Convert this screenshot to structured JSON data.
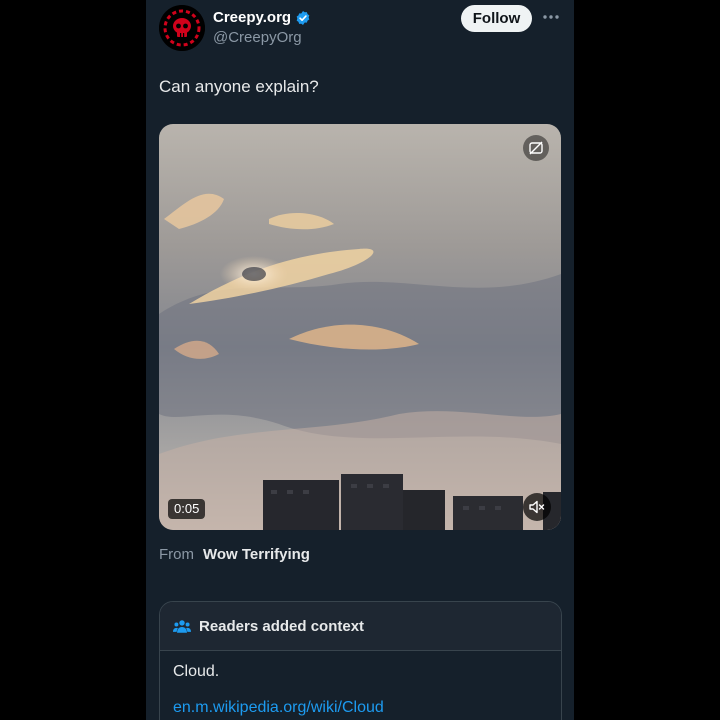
{
  "tweet": {
    "author_name": "Creepy.org",
    "author_handle": "@CreepyOrg",
    "follow_label": "Follow",
    "text": "Can anyone explain?"
  },
  "video": {
    "duration": "0:05"
  },
  "source": {
    "from_label": "From",
    "name": "Wow Terrifying"
  },
  "community_note": {
    "header": "Readers added context",
    "body": "Cloud.",
    "link_text": "en.m.wikipedia.org/wiki/Cloud"
  },
  "colors": {
    "background": "#15202b",
    "accent": "#1d9bf0",
    "secondary_text": "#8b98a5",
    "logo_red": "#d0021b"
  }
}
